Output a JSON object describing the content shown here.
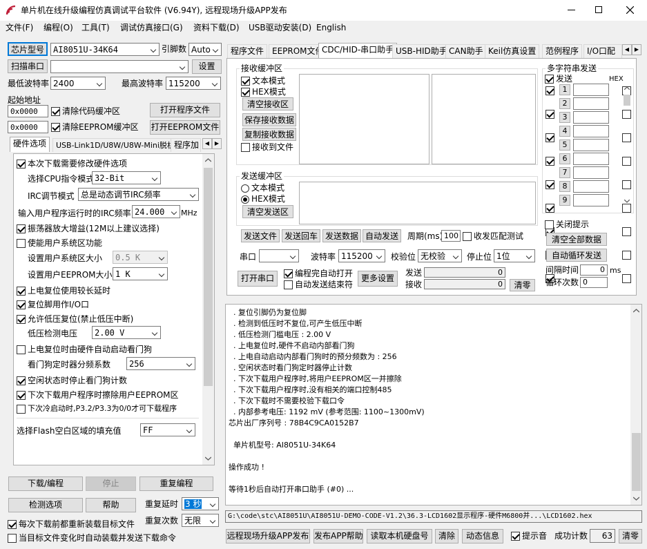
{
  "window": {
    "title": "单片机在线升级编程仿真调试平台软件 (V6.94Y), 远程现场升级APP发布"
  },
  "menu": [
    "文件(F)",
    "编程(O)",
    "工具(T)",
    "调试仿真接口(G)",
    "资料下载(D)",
    "USB驱动安装(D)",
    "English"
  ],
  "left": {
    "chip_btn": "芯片型号",
    "chip_value": "AI8051U-34K64",
    "pins_label": "引脚数",
    "pins_value": "Auto",
    "scan_btn": "扫描串口",
    "port_value": "",
    "settings_btn": "设置",
    "min_baud_label": "最低波特率",
    "min_baud": "2400",
    "max_baud_label": "最高波特率",
    "max_baud": "115200",
    "start_addr_label": "起始地址",
    "addr1": "0x0000",
    "clear_code": "清除代码缓冲区",
    "open_prog": "打开程序文件",
    "addr2": "0x0000",
    "clear_eeprom": "清除EEPROM缓冲区",
    "open_eeprom": "打开EEPROM文件"
  },
  "left_tabs": [
    "硬件选项",
    "USB-Link1D/U8W/U8W-Mini脱机",
    "程序加"
  ],
  "hw": {
    "opt_modify": "本次下载需要修改硬件选项",
    "cpu_label": "选择CPU指令模式",
    "cpu_value": "32-Bit",
    "irc_label": "IRC调节模式",
    "irc_value": "总是动态调节IRC频率",
    "freq_label": "输入用户程序运行时的IRC频率",
    "freq_value": "24.000",
    "freq_unit": "MHz",
    "osc_gain": "振荡器放大增益(12M以上建议选择)",
    "sys_area": "使能用户系统区功能",
    "sys_size_label": "设置用户系统区大小",
    "sys_size": "0.5 K",
    "eeprom_label": "设置用户EEPROM大小",
    "eeprom_value": "1   K",
    "long_delay": "上电复位使用较长延时",
    "reset_io": "复位脚用作I/O口",
    "lvr": "允许低压复位(禁止低压中断)",
    "lvd_label": "低压检测电压",
    "lvd_value": "2.00 V",
    "wdt_start": "上电复位时由硬件自动启动看门狗",
    "wdt_div_label": "看门狗定时器分频系数",
    "wdt_div": "256",
    "idle_wdt": "空闲状态时停止看门狗计数",
    "erase_eeprom": "下次下载用户程序时擦除用户EEPROM区",
    "cold_start": "下次冷启动时,P3.2/P3.3为0/0才可下载程序",
    "fill_label": "选择Flash空白区域的填充值",
    "fill_value": "FF"
  },
  "bottom_left": {
    "download": "下载/编程",
    "stop": "停止",
    "reprogram": "重复编程",
    "check": "检测选项",
    "help": "帮助",
    "repeat_delay_label": "重复延时",
    "repeat_delay": "3 秒",
    "repeat_count_label": "重复次数",
    "repeat_count": "无限",
    "reload_each": "每次下载前都重新装载目标文件",
    "auto_send": "当目标文件变化时自动装载并发送下载命令"
  },
  "right_tabs": [
    "程序文件",
    "EEPROM文件",
    "CDC/HID-串口助手",
    "USB-HID助手",
    "CAN助手",
    "Keil仿真设置",
    "范例程序",
    "I/O口配"
  ],
  "serial": {
    "rx_group": "接收缓冲区",
    "rx_text": "文本模式",
    "rx_hex": "HEX模式",
    "rx_clear": "清空接收区",
    "rx_save": "保存接收数据",
    "rx_copy": "复制接收数据",
    "rx_file": "接收到文件",
    "tx_group": "发送缓冲区",
    "tx_text": "文本模式",
    "tx_hex": "HEX模式",
    "tx_clear": "清空发送区",
    "send_file": "发送文件",
    "send_back": "发送回车",
    "send_data": "发送数据",
    "auto_send": "自动发送",
    "period_label": "周期(ms)",
    "period": "100",
    "match": "收发匹配测试",
    "port_label": "串口",
    "port": "",
    "baud_label": "波特率",
    "baud": "115200",
    "parity_label": "校验位",
    "parity": "无校验",
    "stop_label": "停止位",
    "stop": "1位",
    "open_port": "打开串口",
    "auto_open": "编程完自动打开",
    "auto_end": "自动发送结束符",
    "more": "更多设置",
    "sent_label": "发送",
    "sent": "0",
    "recv_label": "接收",
    "recv": "0",
    "clear": "清零"
  },
  "multi": {
    "title": "多字符串发送",
    "send_hdr": "发送",
    "hex_hdr": "HEX",
    "rows": [
      "1",
      "2",
      "3",
      "4",
      "5",
      "6",
      "7",
      "8",
      "9"
    ],
    "close_tip": "关闭提示",
    "clear_all": "清空全部数据",
    "auto_loop": "自动循环发送",
    "interval_label": "间隔时间",
    "interval": "0",
    "interval_unit": "ms",
    "loop_label": "循环次数",
    "loop": "0"
  },
  "log": [
    "  . 复位引脚仍为复位脚",
    "  . 检测到低压时不复位,可产生低压中断",
    "  . 低压检测门槛电压 : 2.00 V",
    "  . 上电复位时,硬件不启动内部看门狗",
    "  . 上电自动启动内部看门狗时的预分频数为 : 256",
    "  . 空闲状态时看门狗定时器停止计数",
    "  . 下次下载用户程序时,将用户EEPROM区一并擦除",
    "  . 下次下载用户程序时,没有相关的端口控制485",
    "  . 下次下载时不需要校验下载口令",
    "  . 内部参考电压: 1192 mV (参考范围: 1100~1300mV)",
    "芯片出厂序列号 : 78B4C9CA0152B7",
    "",
    "  单片机型号: AI8051U-34K64",
    "",
    "操作成功 !",
    "",
    "等待1秒后自动打开串口助手 (#0) ..."
  ],
  "path": "G:\\code\\stc\\AI8051U\\AI8051U-DEMO-CODE-V1.2\\36.3-LCD1602显示程序-硬件M6800并...\\LCD1602.hex",
  "footer": {
    "remote": "远程现场升级APP发布",
    "app_help": "发布APP帮助",
    "read_disk": "读取本机硬盘号",
    "clear": "清除",
    "dynamic": "动态信息",
    "beep": "提示音",
    "success_label": "成功计数",
    "success": "63",
    "zero": "清零"
  }
}
